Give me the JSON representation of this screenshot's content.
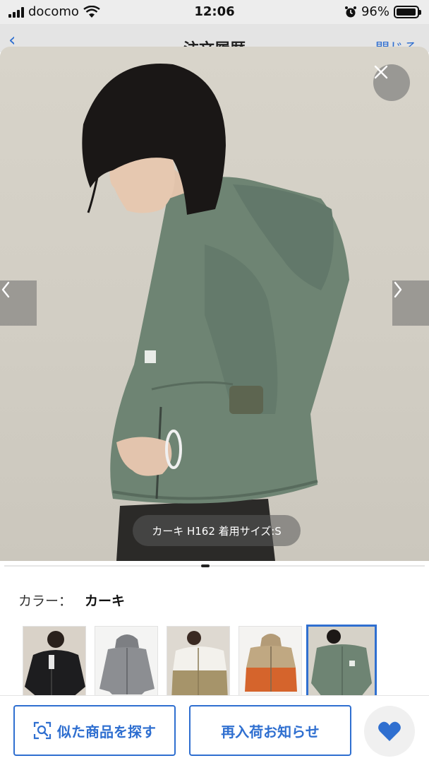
{
  "status_bar": {
    "carrier": "docomo",
    "time": "12:06",
    "battery": "96%",
    "battery_level": 0.96
  },
  "underlying_nav": {
    "title": "注文履歴",
    "close_label": "閉じる"
  },
  "gallery": {
    "caption": "カーキ H162 着用サイズ:S"
  },
  "color": {
    "label": "カラー：",
    "value": "カーキ"
  },
  "swatches": [
    {
      "name": "black",
      "selected": false
    },
    {
      "name": "gray",
      "selected": false
    },
    {
      "name": "beige-white",
      "selected": false
    },
    {
      "name": "orange-beige",
      "selected": false
    },
    {
      "name": "khaki",
      "selected": true
    }
  ],
  "actions": {
    "similar_label": "似た商品を探す",
    "restock_label": "再入荷お知らせ"
  },
  "colors": {
    "accent": "#2f6fd0",
    "jacket": "#6e8473"
  }
}
